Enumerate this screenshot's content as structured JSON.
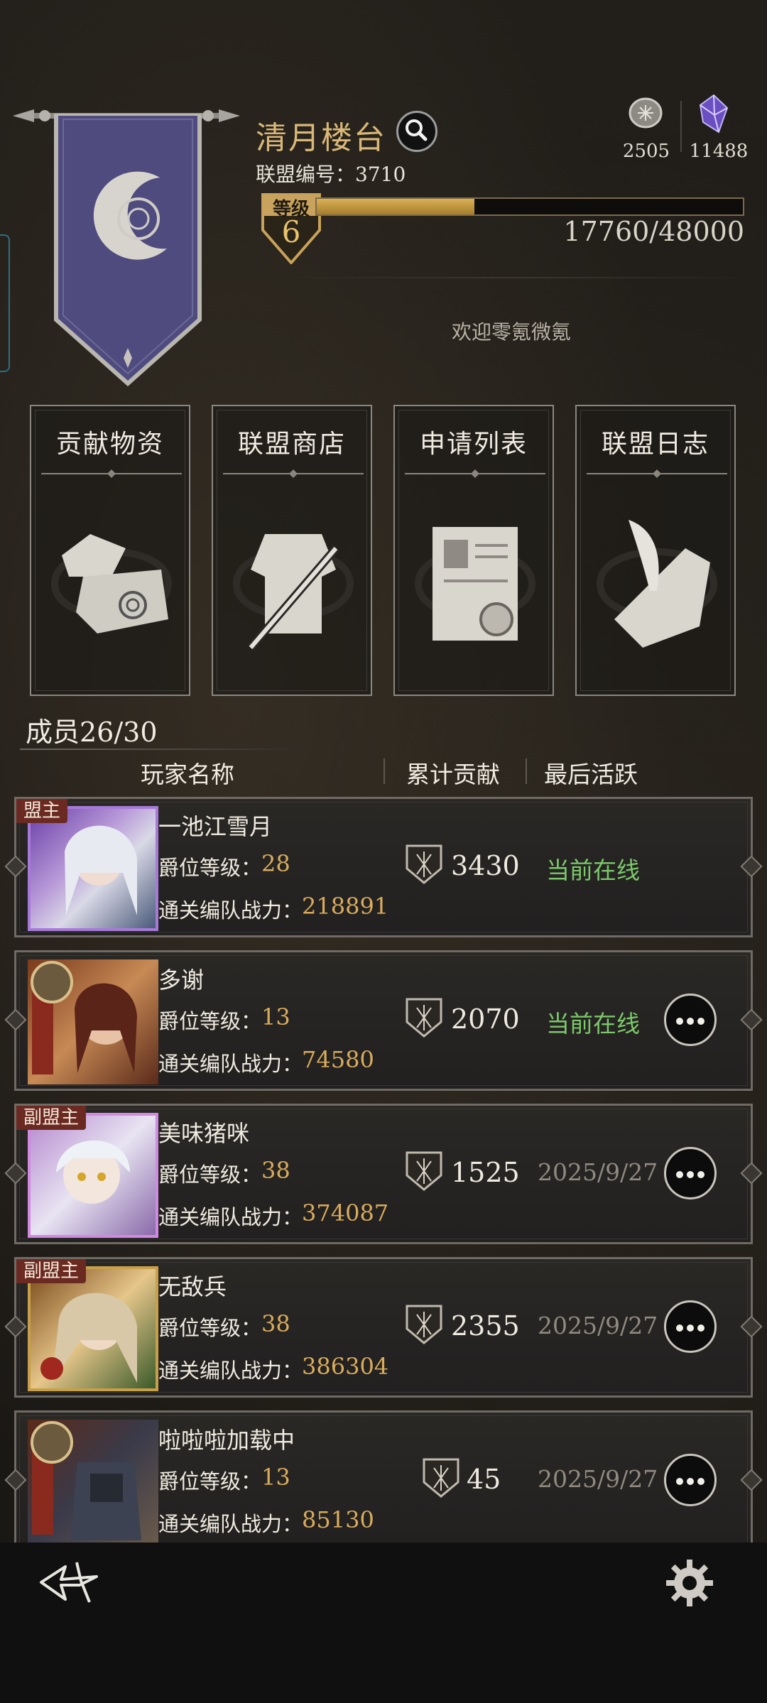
{
  "alliance": {
    "name": "清月楼台",
    "id_label": "联盟编号：3710",
    "level_label": "等级",
    "level": "6",
    "xp_text": "17760/48000",
    "xp_progress": 0.37,
    "welcome": "欢迎零氪微氪"
  },
  "resources": [
    {
      "icon": "coin-icon",
      "value": "2505"
    },
    {
      "icon": "crystal-icon",
      "value": "11488"
    }
  ],
  "cards": [
    {
      "label": "贡献物资",
      "icon": "scroll-bundle-icon"
    },
    {
      "label": "联盟商店",
      "icon": "armor-sword-icon"
    },
    {
      "label": "申请列表",
      "icon": "certificate-icon"
    },
    {
      "label": "联盟日志",
      "icon": "quill-paper-icon"
    }
  ],
  "members": {
    "count_label": "成员26/30",
    "columns": {
      "name": "玩家名称",
      "contribution": "累计贡献",
      "last_active": "最后活跃"
    },
    "rank_label": "爵位等级：",
    "power_label": "通关编队战力：",
    "rows": [
      {
        "role": "盟主",
        "name": "一池江雪月",
        "rank": "28",
        "power": "218891",
        "contribution": "3430",
        "active": "当前在线",
        "online": true,
        "more": false
      },
      {
        "role": "",
        "name": "多谢",
        "rank": "13",
        "power": "74580",
        "contribution": "2070",
        "active": "当前在线",
        "online": true,
        "more": true
      },
      {
        "role": "副盟主",
        "name": "美味猪咪",
        "rank": "38",
        "power": "374087",
        "contribution": "1525",
        "active": "2025/9/27",
        "online": false,
        "more": true
      },
      {
        "role": "副盟主",
        "name": "无敌兵",
        "rank": "38",
        "power": "386304",
        "contribution": "2355",
        "active": "2025/9/27",
        "online": false,
        "more": true
      },
      {
        "role": "",
        "name": "啦啦啦加载中",
        "rank": "13",
        "power": "85130",
        "contribution": "45",
        "active": "2025/9/27",
        "online": false,
        "more": true
      }
    ]
  },
  "colors": {
    "accent_gold": "#d9ac5c",
    "online_green": "#7bc86a",
    "banner_purple": "#4f4b7e"
  }
}
